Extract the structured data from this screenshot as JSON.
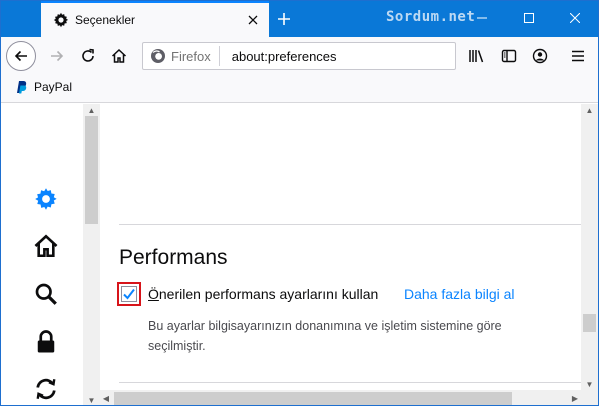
{
  "tab": {
    "title": "Seçenekler",
    "close_label": "✕"
  },
  "newtab": {
    "label": "+"
  },
  "watermark": "Sordum.net",
  "window_controls": {
    "minimize": "—",
    "maximize": "☐",
    "close": "✕"
  },
  "urlbar": {
    "identity_label": "Firefox",
    "url": "about:preferences"
  },
  "bookmarks": [
    {
      "label": "PayPal"
    }
  ],
  "sidebar": {
    "items": [
      {
        "name": "general",
        "icon": "gear-icon",
        "active": true
      },
      {
        "name": "home",
        "icon": "home-icon",
        "active": false
      },
      {
        "name": "search",
        "icon": "search-icon",
        "active": false
      },
      {
        "name": "privacy",
        "icon": "lock-icon",
        "active": false
      },
      {
        "name": "sync",
        "icon": "sync-icon",
        "active": false
      }
    ]
  },
  "performance": {
    "heading": "Performans",
    "checkbox_label_first": "Ö",
    "checkbox_label_rest": "nerilen performans ayarlarını kullan",
    "checked": true,
    "learn_more": "Daha fazla bilgi al",
    "description": "Bu ayarlar bilgisayarınızın donanımına ve işletim sistemine göre seçilmiştir."
  },
  "colors": {
    "accent": "#0a84ff",
    "titlebar": "#0a78d7",
    "highlight_frame": "#d7141a",
    "active_icon": "#0a84ff"
  }
}
